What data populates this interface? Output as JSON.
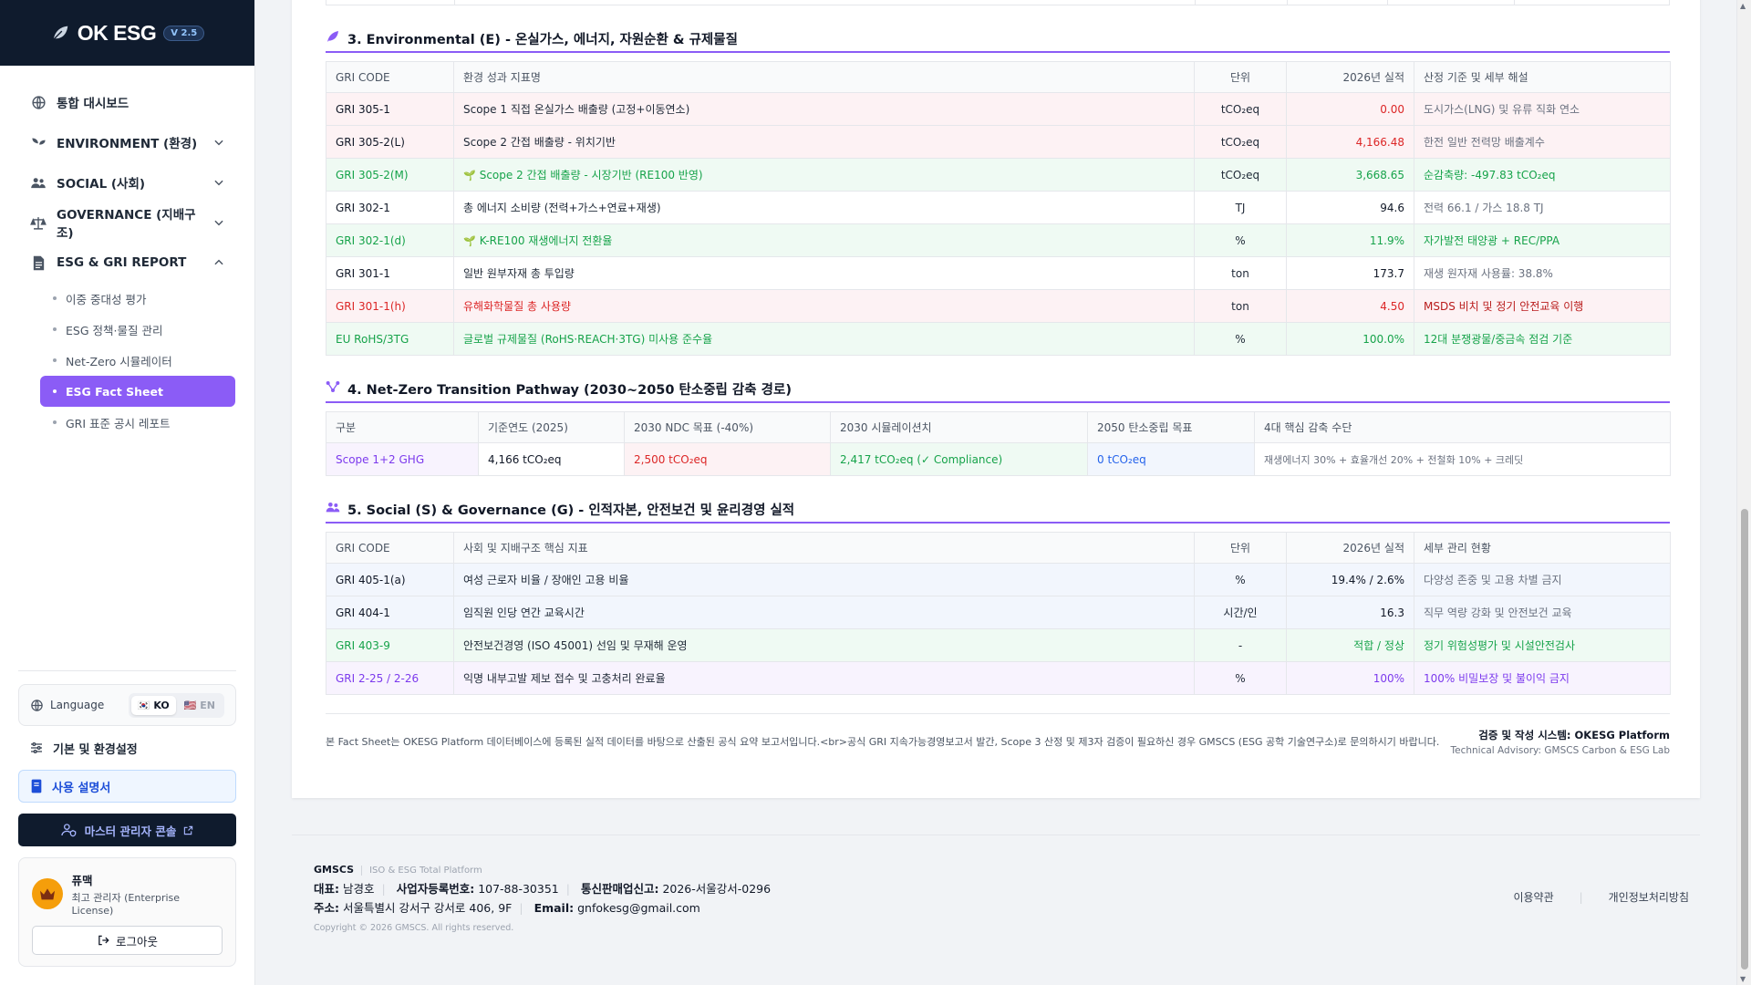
{
  "brand": {
    "name": "OK ESG",
    "version": "V 2.5"
  },
  "nav": {
    "dashboard": "통합 대시보드",
    "environment": "ENVIRONMENT (환경)",
    "social": "SOCIAL (사회)",
    "governance": "GOVERNANCE (지배구조)",
    "esg_report": "ESG & GRI REPORT",
    "sub_items": [
      "이중 중대성 평가",
      "ESG 정책·물질 관리",
      "Net-Zero 시뮬레이터",
      "ESG Fact Sheet",
      "GRI 표준 공시 레포트"
    ]
  },
  "sidebar_bottom": {
    "language_label": "Language",
    "lang_ko": "KO",
    "lang_en": "EN",
    "settings": "기본 및 환경설정",
    "manual": "사용 설명서",
    "admin_console": "마스터 관리자 콘솔",
    "user_name": "퓨맥",
    "user_role": "최고 관리자 (Enterprise License)",
    "logout": "로그아웃"
  },
  "section3": {
    "title": "3. Environmental (E) - 온실가스, 에너지, 자원순환 & 규제물질",
    "headers": [
      "GRI CODE",
      "환경 성과 지표명",
      "단위",
      "2026년 실적",
      "산정 기준 및 세부 해설"
    ],
    "rows": [
      {
        "style": "red",
        "code": "GRI 305-1",
        "name": "Scope 1 직접 온실가스 배출량 (고정+이동연소)",
        "unit": "tCO₂eq",
        "value": "0.00",
        "note": "도시가스(LNG) 및 유류 직화 연소"
      },
      {
        "style": "red",
        "code": "GRI 305-2(L)",
        "name": "Scope 2 간접 배출량 - 위치기반",
        "unit": "tCO₂eq",
        "value": "4,166.48",
        "note": "한전 일반 전력망 배출계수"
      },
      {
        "style": "green",
        "code": "GRI 305-2(M)",
        "name": "Scope 2 간접 배출량 - 시장기반 (RE100 반영)",
        "unit": "tCO₂eq",
        "value": "3,668.65",
        "note": "순감축량: -497.83 tCO₂eq",
        "leaf": "🌱"
      },
      {
        "style": "plain",
        "code": "GRI 302-1",
        "name": "총 에너지 소비량 (전력+가스+연료+재생)",
        "unit": "TJ",
        "value": "94.6",
        "note": "전력 66.1 / 가스 18.8 TJ"
      },
      {
        "style": "green",
        "code": "GRI 302-1(d)",
        "name": "K-RE100 재생에너지 전환율",
        "unit": "%",
        "value": "11.9%",
        "note": "자가발전 태양광 + REC/PPA",
        "leaf": "🌱"
      },
      {
        "style": "plain",
        "code": "GRI 301-1",
        "name": "일반 원부자재 총 투입량",
        "unit": "ton",
        "value": "173.7",
        "note": "재생 원자재 사용률: 38.8%"
      },
      {
        "style": "red",
        "code": "GRI 301-1(h)",
        "name": "유해화학물질 총 사용량",
        "unit": "ton",
        "value": "4.50",
        "note": "MSDS 비치 및 정기 안전교육 이행"
      },
      {
        "style": "green",
        "code": "EU RoHS/3TG",
        "name": "글로벌 규제물질 (RoHS·REACH·3TG) 미사용 준수율",
        "unit": "%",
        "value": "100.0%",
        "note": "12대 분쟁광물/중금속 점검 기준"
      }
    ]
  },
  "section4": {
    "title": "4. Net-Zero Transition Pathway (2030~2050 탄소중립 감축 경로)",
    "headers": [
      "구분",
      "기준연도 (2025)",
      "2030 NDC 목표 (-40%)",
      "2030 시뮬레이션치",
      "2050 탄소중립 목표",
      "4대 핵심 감축 수단"
    ],
    "row": [
      "Scope 1+2 GHG",
      "4,166 tCO₂eq",
      "2,500 tCO₂eq",
      "2,417 tCO₂eq (✓ Compliance)",
      "0 tCO₂eq",
      "재생에너지 30% + 효율개선 20% + 전철화 10% + 크레딧"
    ]
  },
  "section5": {
    "title": "5. Social (S) & Governance (G) - 인적자본, 안전보건 및 윤리경영 실적",
    "headers": [
      "GRI CODE",
      "사회 및 지배구조 핵심 지표",
      "단위",
      "2026년 실적",
      "세부 관리 현황"
    ],
    "rows": [
      {
        "style": "blue",
        "code": "GRI 405-1(a)",
        "name": "여성 근로자 비율 / 장애인 고용 비율",
        "unit": "%",
        "value": "19.4% / 2.6%",
        "note": "다양성 존중 및 고용 차별 금지"
      },
      {
        "style": "blue",
        "code": "GRI 404-1",
        "name": "임직원 인당 연간 교육시간",
        "unit": "시간/인",
        "value": "16.3",
        "note": "직무 역량 강화 및 안전보건 교육"
      },
      {
        "style": "green",
        "code": "GRI 403-9",
        "name": "안전보건경영 (ISO 45001) 선임 및 무재해 운영",
        "unit": "-",
        "value": "적합 / 정상",
        "note": "정기 위험성평가 및 시설안전검사"
      },
      {
        "style": "purple",
        "code": "GRI 2-25 / 2-26",
        "name": "익명 내부고발 제보 접수 및 고충처리 완료율",
        "unit": "%",
        "value": "100%",
        "note": "100% 비밀보장 및 불이익 금지"
      }
    ]
  },
  "footnote": {
    "text": "본 Fact Sheet는 OKESG Platform 데이터베이스에 등록된 실적 데이터를 바탕으로 산출된 공식 요약 보고서입니다.<br>공식 GRI 지속가능경영보고서 발간, Scope 3 산정 및 제3자 검증이 필요하신 경우 GMSCS (ESG 공학 기술연구소)로 문의하시기 바랍니다.",
    "verify_system": "검증 및 작성 시스템: OKESG Platform",
    "advisory": "Technical Advisory: GMSCS Carbon & ESG Lab"
  },
  "footer": {
    "company": "GMSCS",
    "tagline": "ISO & ESG Total Platform",
    "ceo_label": "대표:",
    "ceo": "남경호",
    "bizno_label": "사업자등록번호:",
    "bizno": "107-88-30351",
    "mailorder_label": "통신판매업신고:",
    "mailorder": "2026-서울강서-0296",
    "address_label": "주소:",
    "address": "서울특별시 강서구 강서로 406, 9F",
    "email_label": "Email:",
    "email": "gnfokesg@gmail.com",
    "copyright": "Copyright © 2026 GMSCS. All rights reserved.",
    "terms": "이용약관",
    "privacy": "개인정보처리방침"
  },
  "colors": {
    "accent": "#8b5cf6",
    "navy": "#0f1b2d",
    "red": "#dc2626",
    "green": "#16a34a",
    "blue": "#2563eb",
    "purple": "#7c3aed"
  }
}
